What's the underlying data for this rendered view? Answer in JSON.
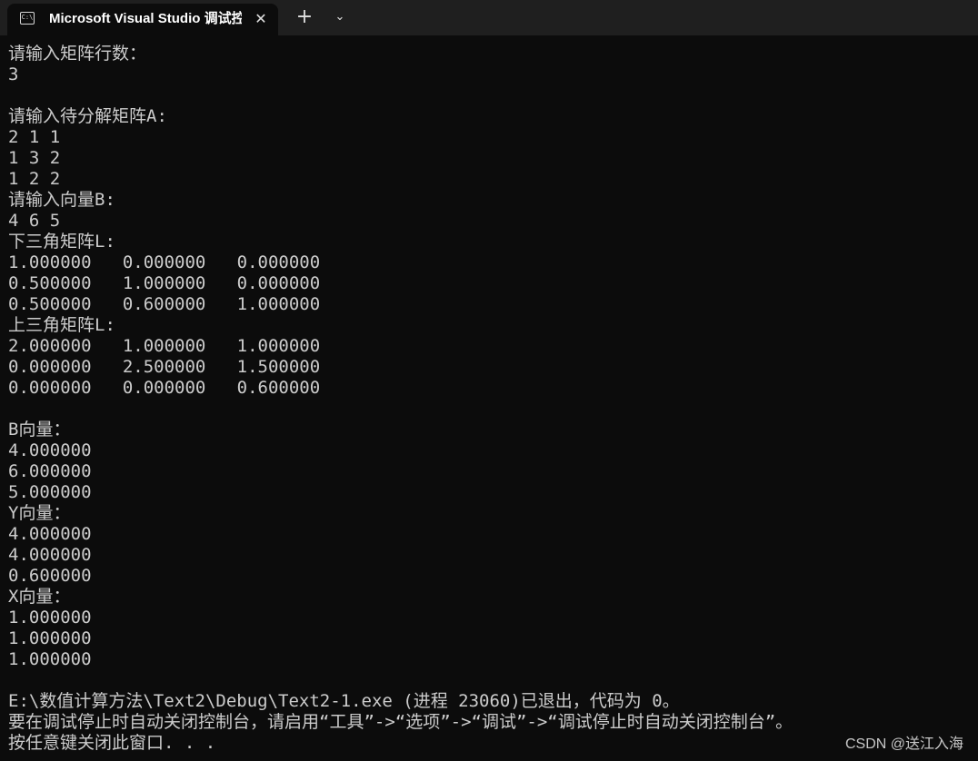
{
  "window": {
    "tab_title": "Microsoft Visual Studio 调试控",
    "tab_icon_glyph": "C:\\",
    "close_glyph": "✕",
    "new_tab_glyph": "+",
    "dropdown_glyph": "⌄",
    "icons": {
      "tab": "console-window-icon",
      "close": "close-icon",
      "new_tab": "plus-icon",
      "dropdown": "chevron-down-icon"
    }
  },
  "console": {
    "lines": [
      "请输入矩阵行数：",
      "3",
      "",
      "请输入待分解矩阵A:",
      "2 1 1",
      "1 3 2",
      "1 2 2",
      "请输入向量B:",
      "4 6 5",
      "下三角矩阵L:",
      "1.000000   0.000000   0.000000",
      "0.500000   1.000000   0.000000",
      "0.500000   0.600000   1.000000",
      "上三角矩阵L:",
      "2.000000   1.000000   1.000000",
      "0.000000   2.500000   1.500000",
      "0.000000   0.000000   0.600000",
      "",
      "B向量：",
      "4.000000",
      "6.000000",
      "5.000000",
      "Y向量：",
      "4.000000",
      "4.000000",
      "0.600000",
      "X向量：",
      "1.000000",
      "1.000000",
      "1.000000",
      "",
      "E:\\数值计算方法\\Text2\\Debug\\Text2-1.exe (进程 23060)已退出，代码为 0。",
      "要在调试停止时自动关闭控制台，请启用“工具”->“选项”->“调试”->“调试停止时自动关闭控制台”。",
      "按任意键关闭此窗口. . ."
    ]
  },
  "watermark": "CSDN @送江入海",
  "colors": {
    "background": "#0c0c0c",
    "titlebar": "#1f1f1f",
    "text": "#cccccc"
  }
}
